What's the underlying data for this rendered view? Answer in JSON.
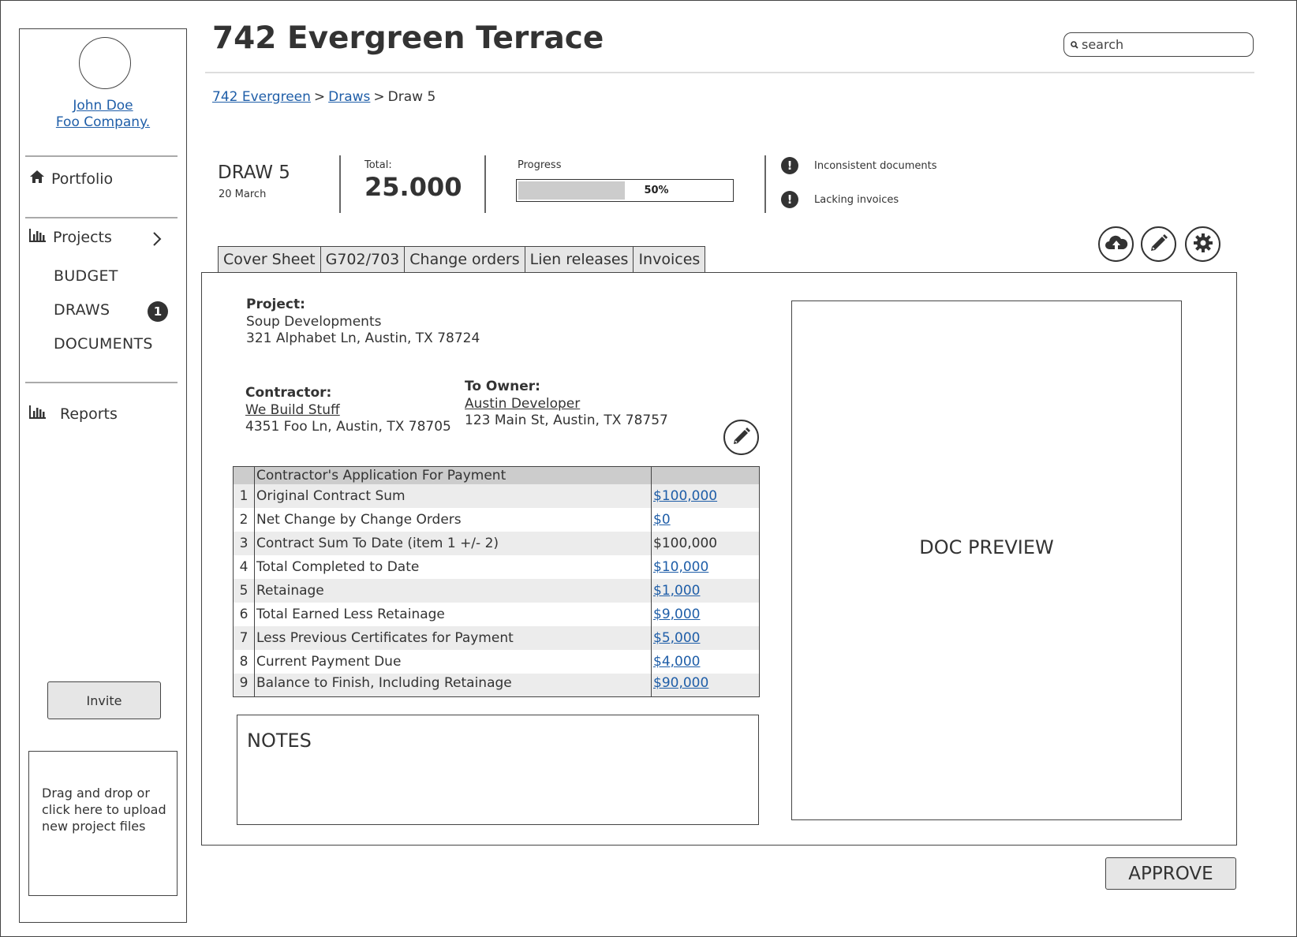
{
  "page": {
    "title": "742 Evergreen Terrace"
  },
  "search": {
    "placeholder": "search"
  },
  "breadcrumb": {
    "items": [
      "742 Evergreen",
      "Draws",
      "Draw 5"
    ],
    "separator": ">"
  },
  "user": {
    "name": "John Doe",
    "company": "Foo Company."
  },
  "sidebar": {
    "portfolio": "Portfolio",
    "projects": "Projects",
    "sub_items": [
      "BUDGET",
      "DRAWS",
      "DOCUMENTS"
    ],
    "draws_badge": "1",
    "reports": "Reports",
    "invite": "Invite",
    "dropzone": "Drag and drop or click here to upload new project files"
  },
  "draw": {
    "title": "DRAW 5",
    "date": "20 March",
    "total_label": "Total:",
    "total_value": "25.000",
    "progress_label": "Progress",
    "progress_text": "50%",
    "progress_fraction": 0.5
  },
  "alerts": [
    "Inconsistent documents",
    "Lacking invoices"
  ],
  "tabs": [
    "Cover Sheet",
    "G702/703",
    "Change orders",
    "Lien releases",
    "Invoices"
  ],
  "cover": {
    "project_label": "Project:",
    "project_name": "Soup Developments",
    "project_address": "321 Alphabet Ln, Austin, TX 78724",
    "contractor_label": "Contractor:",
    "contractor_name": "We Build Stuff",
    "contractor_address": "4351 Foo Ln, Austin, TX 78705",
    "owner_label": "To Owner:",
    "owner_name": "Austin Developer",
    "owner_address": "123 Main St, Austin, TX 78757"
  },
  "payment_table": {
    "header": "Contractor's Application For Payment",
    "rows": [
      {
        "num": "1",
        "label": "Original Contract Sum",
        "value": "$100,000",
        "link": true
      },
      {
        "num": "2",
        "label": "Net Change by Change Orders",
        "value": "$0",
        "link": true
      },
      {
        "num": "3",
        "label": "Contract Sum To Date (item 1 +/- 2)",
        "value": "$100,000",
        "link": false
      },
      {
        "num": "4",
        "label": "Total Completed to Date",
        "value": "$10,000",
        "link": true
      },
      {
        "num": "5",
        "label": "Retainage",
        "value": "$1,000",
        "link": true
      },
      {
        "num": "6",
        "label": "Total Earned Less Retainage",
        "value": "$9,000",
        "link": true
      },
      {
        "num": "7",
        "label": "Less Previous Certificates for Payment",
        "value": "$5,000",
        "link": true
      },
      {
        "num": "8",
        "label": "Current Payment Due",
        "value": "$4,000",
        "link": true
      },
      {
        "num": "9",
        "label": "Balance to Finish, Including Retainage",
        "value": "$90,000",
        "link": true
      }
    ]
  },
  "notes": {
    "title": "NOTES"
  },
  "doc_preview": {
    "label": "DOC PREVIEW"
  },
  "approve": {
    "label": "APPROVE"
  },
  "icons": {
    "home": "home-icon",
    "chart": "bar-chart-icon",
    "chevron": "chevron-right-icon",
    "upload": "cloud-upload-icon",
    "edit": "pencil-icon",
    "settings": "gear-icon",
    "alert": "exclamation-icon",
    "search": "search-icon"
  },
  "colors": {
    "link": "#1f5ea8",
    "tab_bg": "#e6e6e6",
    "badge": "#333333"
  }
}
